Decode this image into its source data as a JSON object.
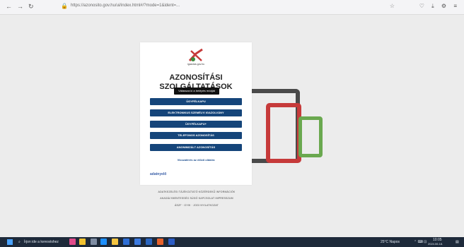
{
  "browser": {
    "back_icon": "←",
    "forward_icon": "→",
    "reload_icon": "↻",
    "url": "https://azonosito.gov.hu/ui/index.html#/?mode=1&ident=...",
    "toolbar_icons": "♡ ⤓ ⚙ ≡"
  },
  "card": {
    "logo_caption": "igazolas.gov.hu",
    "title_line1": "AZONOSÍTÁSI",
    "title_line2": "SZOLGÁLTATÁSOK",
    "tooltip": "Válassza ki a belépés módját",
    "buttons": [
      "ÜGYFÉLKAPU",
      "ELEKTRONIKUS SZEMÉLYI IGAZOLVÁNY",
      "ÜGYFÉLKAPU+",
      "TELEFONOS AZONOSÍTÁS",
      "ANONIMIZÁLT AZONOSÍTÁS"
    ],
    "back_link": "Visszatérés az előző oldalra",
    "brand": "adatnyelő"
  },
  "footer": {
    "line1": "ADATKEZELÉSI TÁJÉKOZTATÓ   KÖZÉRDEKŰ INFORMÁCIÓK",
    "line2": "AKADÁLYMENTESSÉG   SÚGÓ   KAPCSOLAT   IMPRESSZUM",
    "line3": "ÁSZF · GYIK · JOGI NYILATKOZAT"
  },
  "taskbar": {
    "search_placeholder": "Írjon ide a kereséshez",
    "weather": "25°C Napos",
    "time": "10:05",
    "date": "2024.06.18."
  },
  "colors": {
    "button_bg": "#15457a",
    "frame_dark": "#4a4a4a",
    "tablet_red": "#c63a3a",
    "phone_green": "#6aa84f"
  }
}
